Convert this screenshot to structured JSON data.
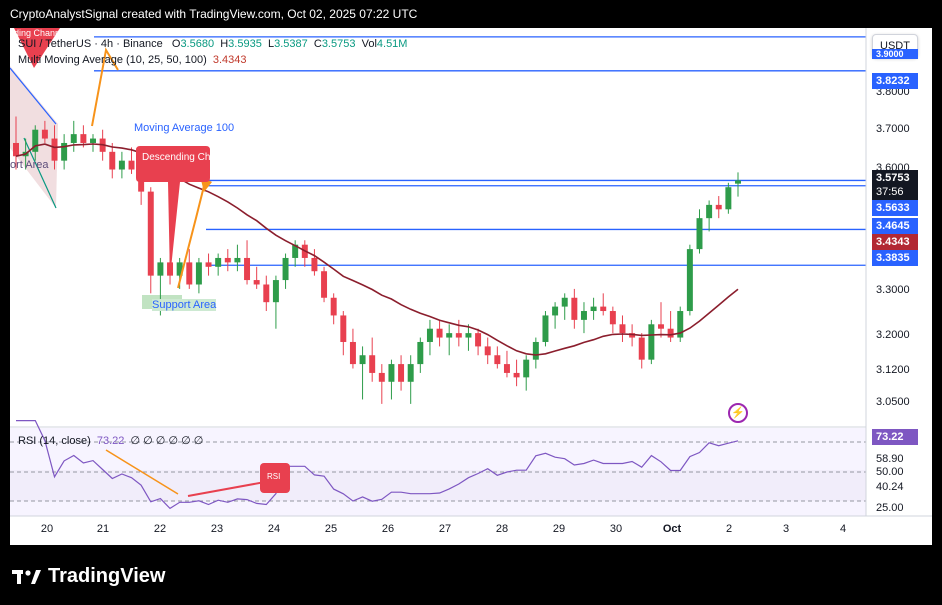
{
  "header": {
    "text": "CryptoAnalystSignal created with TradingView.com, Oct 02, 2025 07:22 UTC"
  },
  "legend": {
    "symbol": "SUI / TetherUS · 4h · Binance",
    "o_label": "O",
    "o": "3.5680",
    "h_label": "H",
    "h": "3.5935",
    "l_label": "L",
    "l": "3.5387",
    "c_label": "C",
    "c": "3.5753",
    "vol_label": "Vol",
    "vol": "4.51M",
    "ma_label": "Multi Moving Average (10, 25, 50, 100)",
    "ma_value": "3.4343"
  },
  "currency_button": "USDT",
  "annotations": {
    "ma100": "Moving Average 100",
    "descending_channel": "Descending Channel",
    "descending_channel_top": "ending Channel",
    "support_area": "Support Area",
    "support_area_left": "ort Area",
    "rsi_tag": "RSI"
  },
  "price_axis": [
    "3.8000",
    "3.7000",
    "3.6000",
    "3.3000",
    "3.2000",
    "3.1200",
    "3.0500"
  ],
  "price_tags": {
    "top_level": "3.9000",
    "r1": "3.8232",
    "current": "3.5753",
    "countdown": "37:56",
    "s1": "3.5633",
    "s2": "3.4645",
    "ma": "3.4343",
    "s3": "3.3835"
  },
  "rsi": {
    "label": "RSI (14, close)",
    "value_inline": "73.22",
    "placeholders": "∅ ∅ ∅ ∅ ∅ ∅",
    "tag": "73.22",
    "levels": [
      "58.90",
      "50.00",
      "40.24",
      "25.00"
    ]
  },
  "time_axis": [
    "20",
    "21",
    "22",
    "23",
    "24",
    "25",
    "26",
    "27",
    "28",
    "29",
    "30",
    "Oct",
    "2",
    "3",
    "4"
  ],
  "brand": "TradingView",
  "colors": {
    "up": "#2e9c4a",
    "down": "#e8404f",
    "ma": "#8b1e2d",
    "level": "#2962ff",
    "rsi": "#7e57c2",
    "annotation": "#f7931a"
  },
  "chart_data": {
    "type": "candlestick",
    "interval": "4h",
    "symbol": "SUI/USDT",
    "x_categories": [
      "20",
      "21",
      "22",
      "23",
      "24",
      "25",
      "26",
      "27",
      "28",
      "29",
      "30",
      "Oct",
      "2"
    ],
    "ylim": [
      3.02,
      3.92
    ],
    "horizontal_levels": [
      3.9,
      3.8232,
      3.5753,
      3.5633,
      3.4645,
      3.3835
    ],
    "candles": [
      [
        3.66,
        3.72,
        3.6,
        3.63
      ],
      [
        3.63,
        3.67,
        3.6,
        3.64
      ],
      [
        3.64,
        3.7,
        3.62,
        3.69
      ],
      [
        3.69,
        3.71,
        3.66,
        3.67
      ],
      [
        3.67,
        3.7,
        3.6,
        3.62
      ],
      [
        3.62,
        3.68,
        3.6,
        3.66
      ],
      [
        3.66,
        3.71,
        3.64,
        3.68
      ],
      [
        3.68,
        3.7,
        3.65,
        3.66
      ],
      [
        3.66,
        3.68,
        3.64,
        3.67
      ],
      [
        3.67,
        3.69,
        3.62,
        3.64
      ],
      [
        3.64,
        3.66,
        3.58,
        3.6
      ],
      [
        3.6,
        3.64,
        3.58,
        3.62
      ],
      [
        3.62,
        3.65,
        3.59,
        3.6
      ],
      [
        3.6,
        3.61,
        3.52,
        3.55
      ],
      [
        3.55,
        3.56,
        3.32,
        3.36
      ],
      [
        3.36,
        3.4,
        3.27,
        3.39
      ],
      [
        3.39,
        3.42,
        3.34,
        3.36
      ],
      [
        3.36,
        3.4,
        3.33,
        3.39
      ],
      [
        3.39,
        3.42,
        3.33,
        3.34
      ],
      [
        3.34,
        3.4,
        3.32,
        3.39
      ],
      [
        3.39,
        3.41,
        3.36,
        3.38
      ],
      [
        3.38,
        3.41,
        3.36,
        3.4
      ],
      [
        3.4,
        3.42,
        3.37,
        3.39
      ],
      [
        3.39,
        3.43,
        3.37,
        3.4
      ],
      [
        3.4,
        3.44,
        3.34,
        3.35
      ],
      [
        3.35,
        3.38,
        3.33,
        3.34
      ],
      [
        3.34,
        3.36,
        3.28,
        3.3
      ],
      [
        3.3,
        3.36,
        3.24,
        3.35
      ],
      [
        3.35,
        3.41,
        3.33,
        3.4
      ],
      [
        3.4,
        3.44,
        3.38,
        3.43
      ],
      [
        3.43,
        3.44,
        3.38,
        3.4
      ],
      [
        3.4,
        3.42,
        3.36,
        3.37
      ],
      [
        3.37,
        3.38,
        3.3,
        3.31
      ],
      [
        3.31,
        3.32,
        3.25,
        3.27
      ],
      [
        3.27,
        3.28,
        3.18,
        3.21
      ],
      [
        3.21,
        3.24,
        3.15,
        3.16
      ],
      [
        3.16,
        3.2,
        3.08,
        3.18
      ],
      [
        3.18,
        3.22,
        3.12,
        3.14
      ],
      [
        3.14,
        3.16,
        3.07,
        3.12
      ],
      [
        3.12,
        3.17,
        3.08,
        3.16
      ],
      [
        3.16,
        3.18,
        3.1,
        3.12
      ],
      [
        3.12,
        3.18,
        3.07,
        3.16
      ],
      [
        3.16,
        3.22,
        3.14,
        3.21
      ],
      [
        3.21,
        3.26,
        3.18,
        3.24
      ],
      [
        3.24,
        3.26,
        3.2,
        3.22
      ],
      [
        3.22,
        3.25,
        3.18,
        3.23
      ],
      [
        3.23,
        3.26,
        3.2,
        3.22
      ],
      [
        3.22,
        3.25,
        3.19,
        3.23
      ],
      [
        3.23,
        3.24,
        3.18,
        3.2
      ],
      [
        3.2,
        3.22,
        3.16,
        3.18
      ],
      [
        3.18,
        3.2,
        3.15,
        3.16
      ],
      [
        3.16,
        3.19,
        3.13,
        3.14
      ],
      [
        3.14,
        3.17,
        3.11,
        3.13
      ],
      [
        3.13,
        3.18,
        3.1,
        3.17
      ],
      [
        3.17,
        3.22,
        3.15,
        3.21
      ],
      [
        3.21,
        3.28,
        3.2,
        3.27
      ],
      [
        3.27,
        3.3,
        3.24,
        3.29
      ],
      [
        3.29,
        3.32,
        3.26,
        3.31
      ],
      [
        3.31,
        3.33,
        3.24,
        3.26
      ],
      [
        3.26,
        3.3,
        3.23,
        3.28
      ],
      [
        3.28,
        3.31,
        3.26,
        3.29
      ],
      [
        3.29,
        3.32,
        3.27,
        3.28
      ],
      [
        3.28,
        3.29,
        3.23,
        3.25
      ],
      [
        3.25,
        3.27,
        3.21,
        3.23
      ],
      [
        3.23,
        3.25,
        3.2,
        3.22
      ],
      [
        3.22,
        3.23,
        3.15,
        3.17
      ],
      [
        3.17,
        3.26,
        3.16,
        3.25
      ],
      [
        3.25,
        3.3,
        3.22,
        3.24
      ],
      [
        3.24,
        3.28,
        3.21,
        3.22
      ],
      [
        3.22,
        3.29,
        3.21,
        3.28
      ],
      [
        3.28,
        3.43,
        3.27,
        3.42
      ],
      [
        3.42,
        3.51,
        3.41,
        3.49
      ],
      [
        3.49,
        3.53,
        3.46,
        3.52
      ],
      [
        3.52,
        3.54,
        3.49,
        3.51
      ],
      [
        3.51,
        3.57,
        3.5,
        3.56
      ],
      [
        3.568,
        3.5935,
        3.5387,
        3.5753
      ]
    ]
  }
}
